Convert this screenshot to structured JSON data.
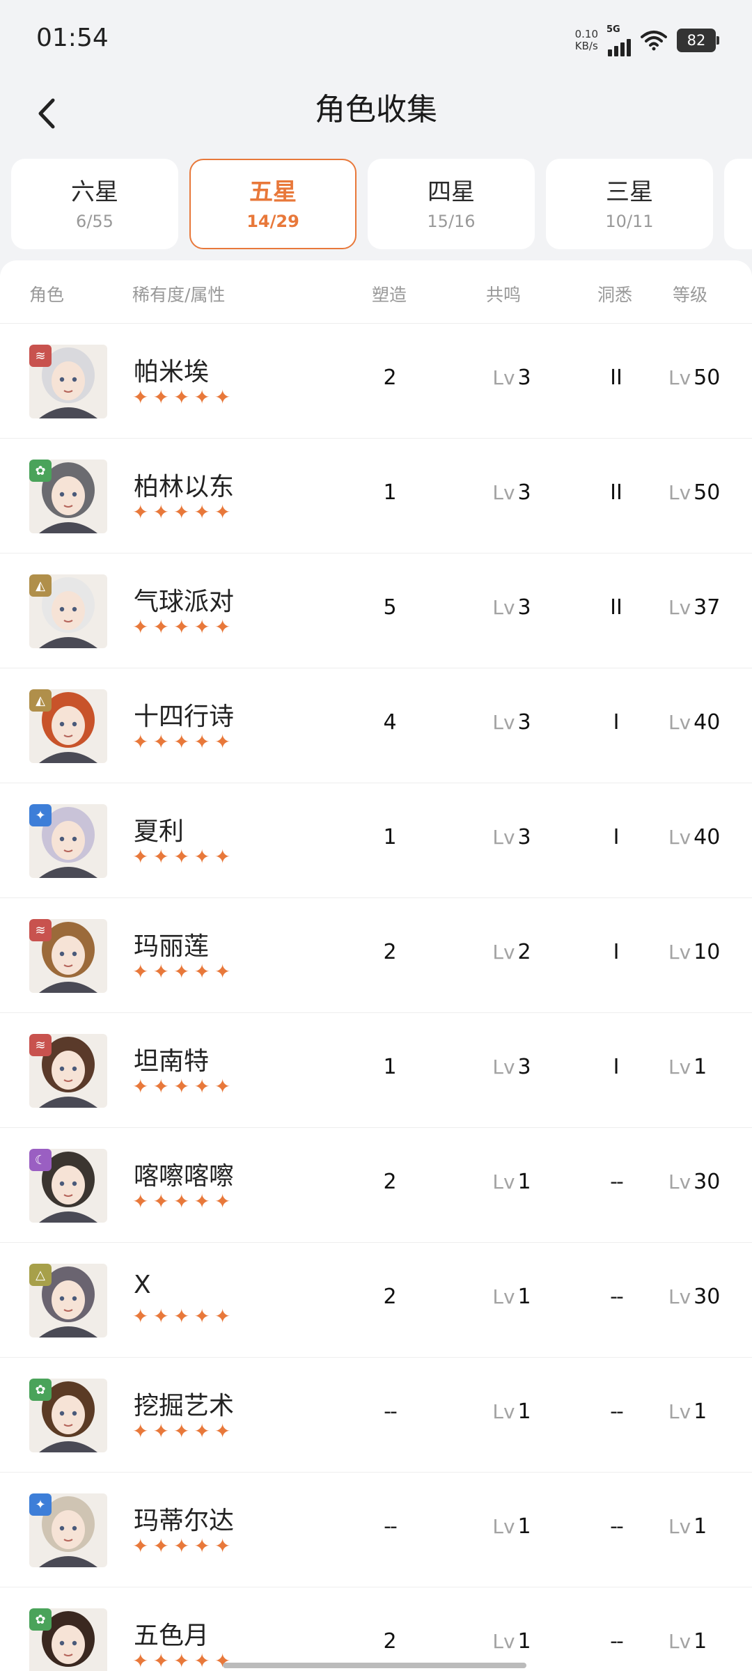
{
  "status_bar": {
    "time": "01:54",
    "speed_value": "0.10",
    "speed_unit": "KB/s",
    "network": "5G",
    "battery": "82"
  },
  "header": {
    "title": "角色收集"
  },
  "tabs": [
    {
      "name": "六星",
      "count": "6/55",
      "active": false
    },
    {
      "name": "五星",
      "count": "14/29",
      "active": true
    },
    {
      "name": "四星",
      "count": "15/16",
      "active": false
    },
    {
      "name": "三星",
      "count": "10/11",
      "active": false
    }
  ],
  "columns": {
    "role": "角色",
    "rarity": "稀有度/属性",
    "shape": "塑造",
    "resonance": "共鸣",
    "insight": "洞悉",
    "level": "等级"
  },
  "lv_prefix": "Lv",
  "colors": {
    "accent": "#e8783a",
    "red_elem": "#c8524e",
    "green_elem": "#4aa35a",
    "gold_elem": "#b08f4a",
    "blue_elem": "#3d7ed8",
    "purple_elem": "#9a5fc2",
    "olive_elem": "#a7a04a"
  },
  "characters": [
    {
      "name": "帕米埃",
      "element": "beast",
      "element_color": "#c8524e",
      "stars": 5,
      "shape": "2",
      "resonance": "3",
      "insight": "II",
      "level": "50"
    },
    {
      "name": "柏林以东",
      "element": "plant",
      "element_color": "#4aa35a",
      "stars": 5,
      "shape": "1",
      "resonance": "3",
      "insight": "II",
      "level": "50"
    },
    {
      "name": "气球派对",
      "element": "mineral",
      "element_color": "#b08f4a",
      "stars": 5,
      "shape": "5",
      "resonance": "3",
      "insight": "II",
      "level": "37"
    },
    {
      "name": "十四行诗",
      "element": "mineral",
      "element_color": "#b08f4a",
      "stars": 5,
      "shape": "4",
      "resonance": "3",
      "insight": "I",
      "level": "40"
    },
    {
      "name": "夏利",
      "element": "star",
      "element_color": "#3d7ed8",
      "stars": 5,
      "shape": "1",
      "resonance": "3",
      "insight": "I",
      "level": "40"
    },
    {
      "name": "玛丽莲",
      "element": "beast",
      "element_color": "#c8524e",
      "stars": 5,
      "shape": "2",
      "resonance": "2",
      "insight": "I",
      "level": "10"
    },
    {
      "name": "坦南特",
      "element": "beast",
      "element_color": "#c8524e",
      "stars": 5,
      "shape": "1",
      "resonance": "3",
      "insight": "I",
      "level": "1"
    },
    {
      "name": "喀嚓喀嚓",
      "element": "spirit",
      "element_color": "#9a5fc2",
      "stars": 5,
      "shape": "2",
      "resonance": "1",
      "insight": "--",
      "level": "30"
    },
    {
      "name": "X",
      "element": "intellect",
      "element_color": "#a7a04a",
      "stars": 5,
      "shape": "2",
      "resonance": "1",
      "insight": "--",
      "level": "30"
    },
    {
      "name": "挖掘艺术",
      "element": "plant",
      "element_color": "#4aa35a",
      "stars": 5,
      "shape": "--",
      "resonance": "1",
      "insight": "--",
      "level": "1"
    },
    {
      "name": "玛蒂尔达",
      "element": "star",
      "element_color": "#3d7ed8",
      "stars": 5,
      "shape": "--",
      "resonance": "1",
      "insight": "--",
      "level": "1"
    },
    {
      "name": "五色月",
      "element": "plant",
      "element_color": "#4aa35a",
      "stars": 5,
      "shape": "2",
      "resonance": "1",
      "insight": "--",
      "level": "1"
    }
  ]
}
